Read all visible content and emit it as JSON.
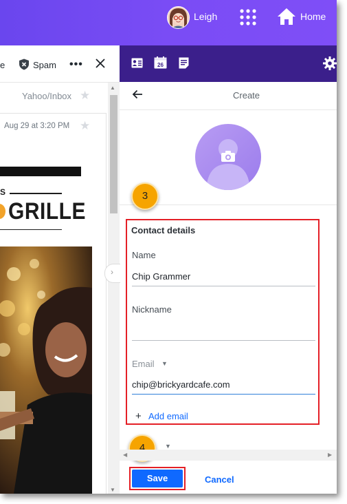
{
  "header": {
    "user_name": "Leigh",
    "home_label": "Home"
  },
  "message_toolbar": {
    "truncated_label": "e",
    "spam_label": "Spam",
    "more_label": "•••"
  },
  "message": {
    "folder_path": "Yahoo/Inbox",
    "date": "Aug 29 at 3:20 PM",
    "brand_fragment": "S",
    "brand_text": "GRILLE"
  },
  "contact_pane": {
    "toolbar_icons": [
      "contacts-icon",
      "calendar-icon",
      "notepad-icon",
      "gear-icon"
    ],
    "calendar_day": "26",
    "title": "Create",
    "section_title": "Contact details",
    "name_label": "Name",
    "name_value": "Chip Grammer",
    "nickname_label": "Nickname",
    "nickname_value": "",
    "email_label": "Email",
    "email_value": "chip@brickyardcafe.com",
    "add_email_label": "Add email",
    "save_label": "Save",
    "cancel_label": "Cancel"
  },
  "annotations": {
    "step3": "3",
    "step4": "4"
  },
  "colors": {
    "header_purple": "#7a4cf5",
    "toolbar_dark_purple": "#3b1f8b",
    "link_blue": "#0f69ff",
    "highlight_red": "#e41f26",
    "step_orange": "#f6a400"
  }
}
